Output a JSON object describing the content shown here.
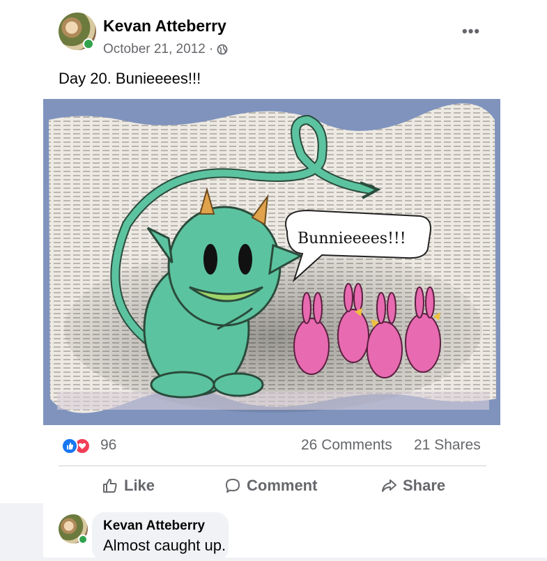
{
  "post": {
    "author": "Kevan Atteberry",
    "date": "October 21, 2012",
    "date_separator": "·",
    "privacy_icon": "globe-icon",
    "more_icon": "•••",
    "text": "Day 20. Bunieeees!!!"
  },
  "image": {
    "speech_text": "Bunnieeees!!!"
  },
  "stats": {
    "reaction_icons": [
      "like-icon",
      "love-icon"
    ],
    "reaction_count": "96",
    "comments": "26 Comments",
    "shares": "21 Shares"
  },
  "actions": {
    "like": "Like",
    "comment": "Comment",
    "share": "Share"
  },
  "comment": {
    "author": "Kevan Atteberry",
    "text": "Almost caught up."
  },
  "colors": {
    "like_blue": "#1877f2",
    "love_red": "#f33e58",
    "online_green": "#31a24c",
    "secondary_text": "#65676b"
  }
}
